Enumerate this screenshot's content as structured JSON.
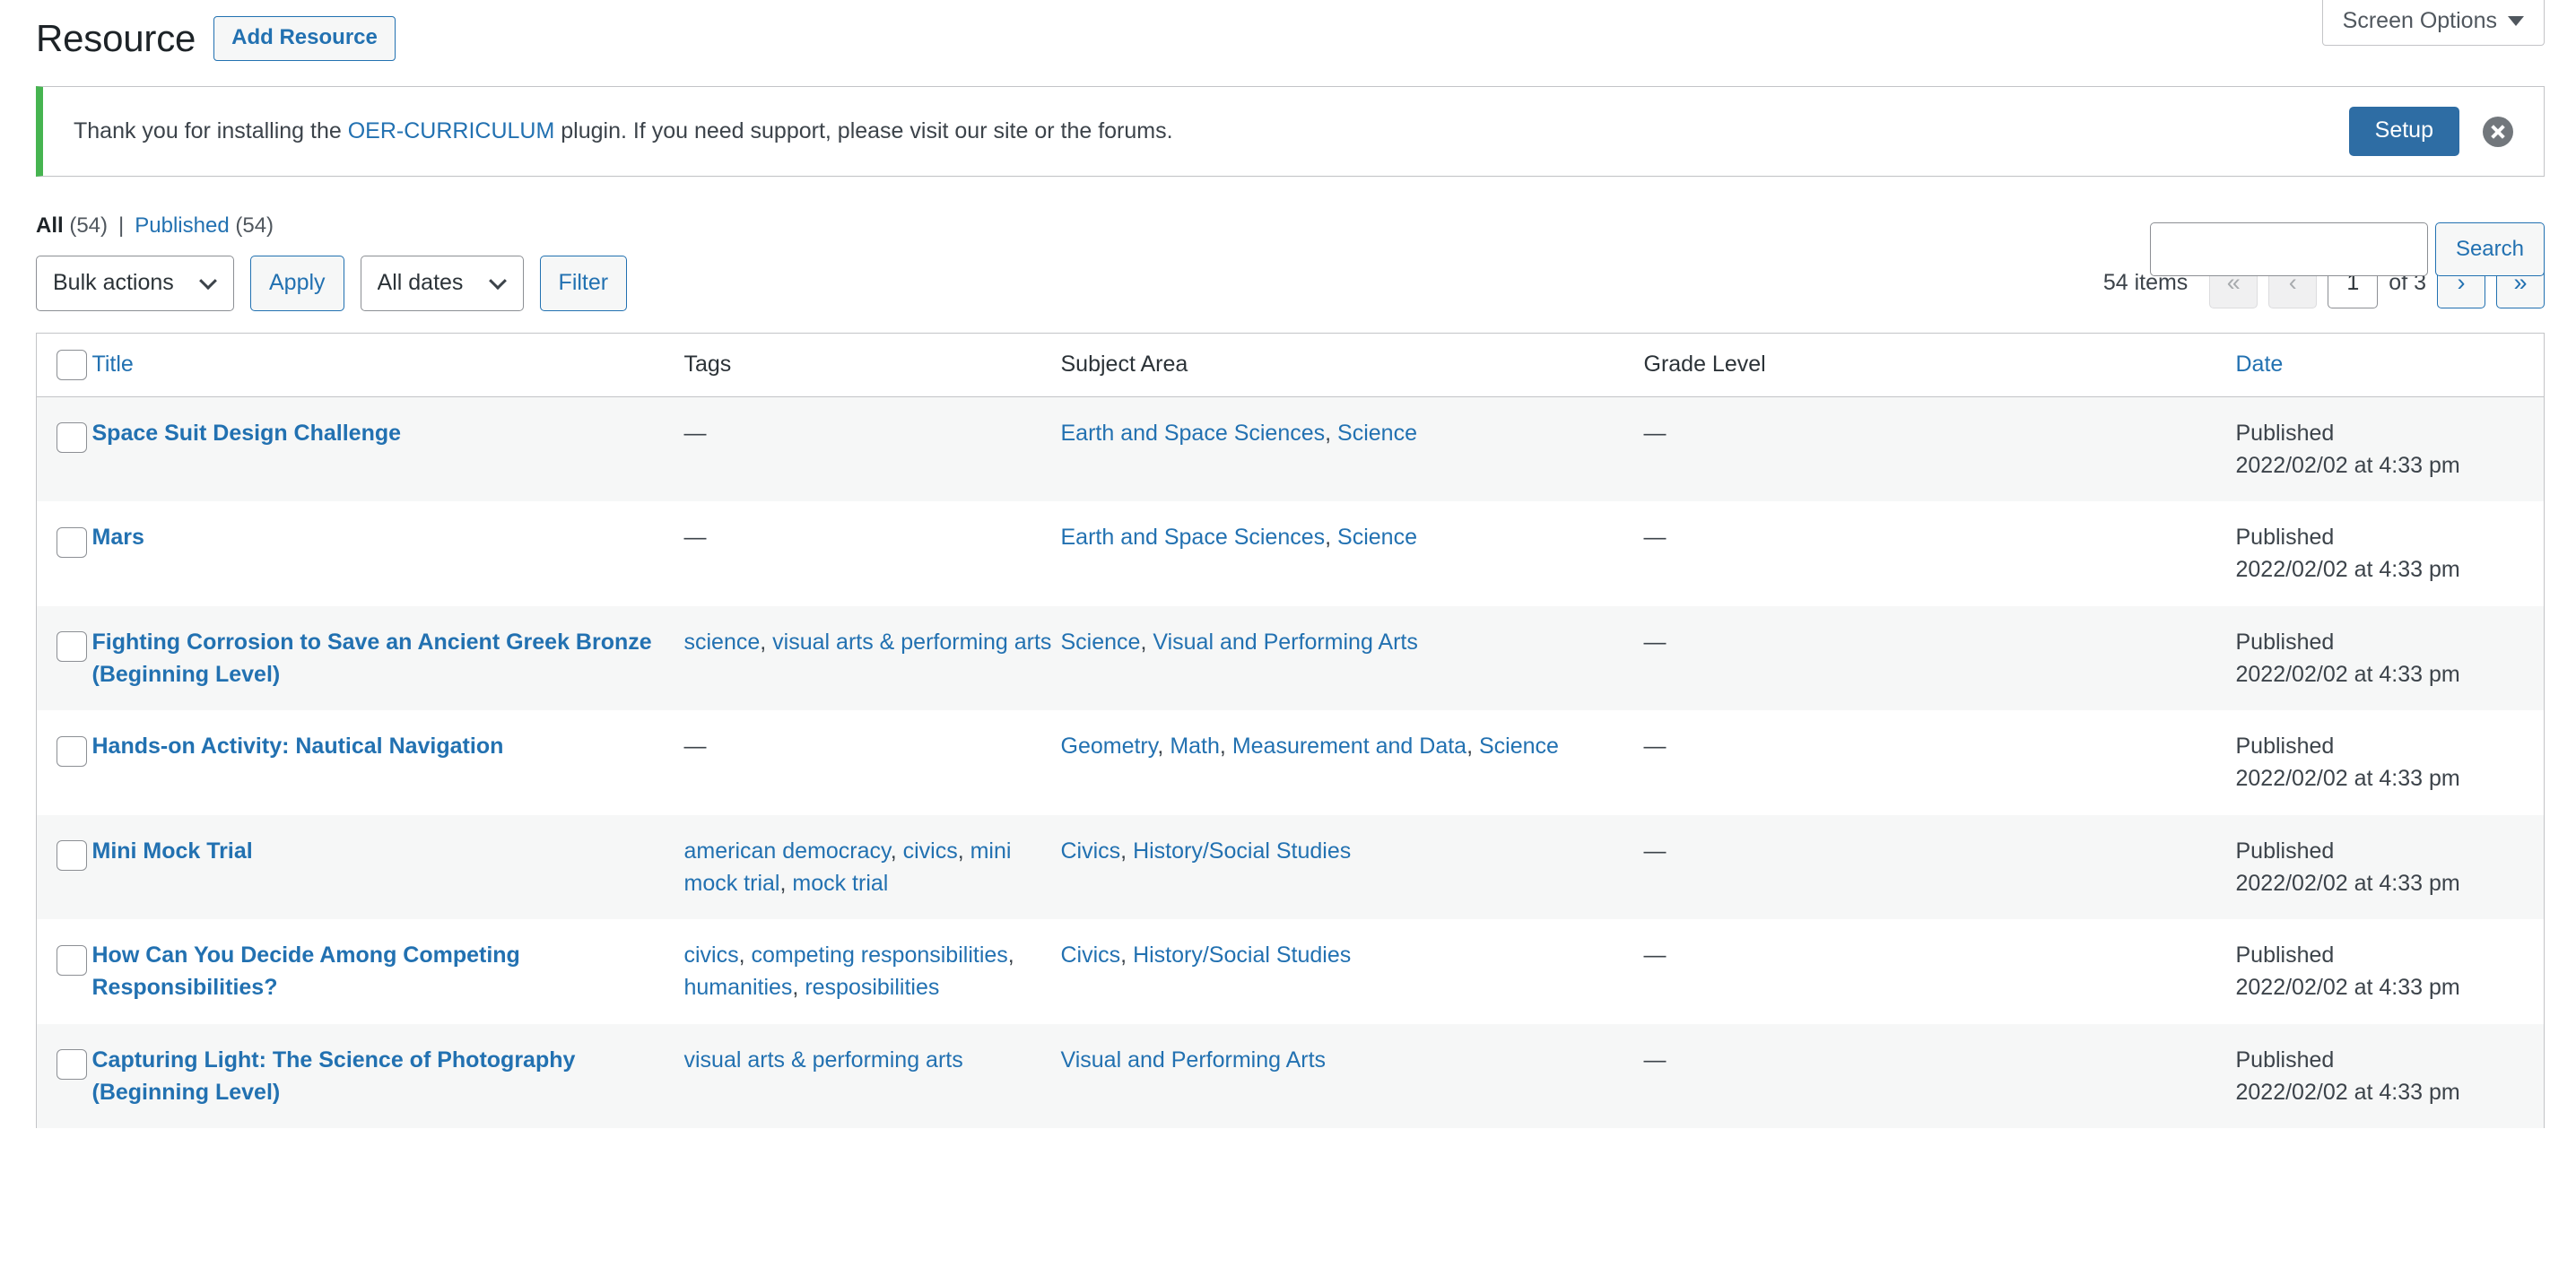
{
  "screen_meta": {
    "screen_options_label": "Screen Options",
    "caret_icon": "chevron-down-icon"
  },
  "header": {
    "page_title": "Resource",
    "add_button_label": "Add Resource"
  },
  "notice": {
    "text_before_link": "Thank you for installing the ",
    "link_text": "OER-CURRICULUM",
    "text_after_link": " plugin. If you need support, please visit our site or the forums.",
    "setup_button_label": "Setup",
    "dismiss_icon": "close-circle-icon",
    "accent_color": "#46b450",
    "setup_button_color": "#2e6da4"
  },
  "status_links": {
    "all_label": "All",
    "all_count": "(54)",
    "separator": "|",
    "published_label": "Published",
    "published_count": "(54)"
  },
  "search": {
    "value": "",
    "placeholder": "",
    "button_label": "Search"
  },
  "tablenav": {
    "bulk_actions_selected": "Bulk actions",
    "apply_label": "Apply",
    "dates_selected": "All dates",
    "filter_label": "Filter",
    "displaying_num": "54 items",
    "first_page_label": "«",
    "prev_page_label": "‹",
    "current_page": "1",
    "total_pages_label": "of 3",
    "next_page_label": "›",
    "last_page_label": "»"
  },
  "table": {
    "columns": {
      "title": "Title",
      "tags": "Tags",
      "subject_area": "Subject Area",
      "grade_level": "Grade Level",
      "date": "Date"
    },
    "rows": [
      {
        "title": "Space Suit Design Challenge",
        "tags": [
          "—"
        ],
        "tags_empty": true,
        "subjects": [
          "Earth and Space Sciences",
          "Science"
        ],
        "grade_level": "—",
        "date_status": "Published",
        "date_value": "2022/02/02 at 4:33 pm"
      },
      {
        "title": "Mars",
        "tags": [
          "—"
        ],
        "tags_empty": true,
        "subjects": [
          "Earth and Space Sciences",
          "Science"
        ],
        "grade_level": "—",
        "date_status": "Published",
        "date_value": "2022/02/02 at 4:33 pm"
      },
      {
        "title": "Fighting Corrosion to Save an Ancient Greek Bronze (Beginning Level)",
        "tags": [
          "science",
          "visual arts & performing arts"
        ],
        "tags_empty": false,
        "subjects": [
          "Science",
          "Visual and Performing Arts"
        ],
        "grade_level": "—",
        "date_status": "Published",
        "date_value": "2022/02/02 at 4:33 pm"
      },
      {
        "title": "Hands-on Activity: Nautical Navigation",
        "tags": [
          "—"
        ],
        "tags_empty": true,
        "subjects": [
          "Geometry",
          "Math",
          "Measurement and Data",
          "Science"
        ],
        "grade_level": "—",
        "date_status": "Published",
        "date_value": "2022/02/02 at 4:33 pm"
      },
      {
        "title": "Mini Mock Trial",
        "tags": [
          "american democracy",
          "civics",
          "mini mock trial",
          "mock trial"
        ],
        "tags_empty": false,
        "subjects": [
          "Civics",
          "History/Social Studies"
        ],
        "grade_level": "—",
        "date_status": "Published",
        "date_value": "2022/02/02 at 4:33 pm"
      },
      {
        "title": "How Can You Decide Among Competing Responsibilities?",
        "tags": [
          "civics",
          "competing responsibilities",
          "humanities",
          "resposibilities"
        ],
        "tags_empty": false,
        "subjects": [
          "Civics",
          "History/Social Studies"
        ],
        "grade_level": "—",
        "date_status": "Published",
        "date_value": "2022/02/02 at 4:33 pm"
      },
      {
        "title": "Capturing Light: The Science of Photography (Beginning Level)",
        "tags": [
          "visual arts & performing arts"
        ],
        "tags_empty": false,
        "subjects": [
          "Visual and Performing Arts"
        ],
        "grade_level": "—",
        "date_status": "Published",
        "date_value": "2022/02/02 at 4:33 pm"
      }
    ]
  },
  "colors": {
    "link": "#2271b1",
    "title_text": "#1d2327",
    "body_text": "#3c434a",
    "row_alt_bg": "#f6f7f7",
    "border": "#c3c4c7"
  }
}
